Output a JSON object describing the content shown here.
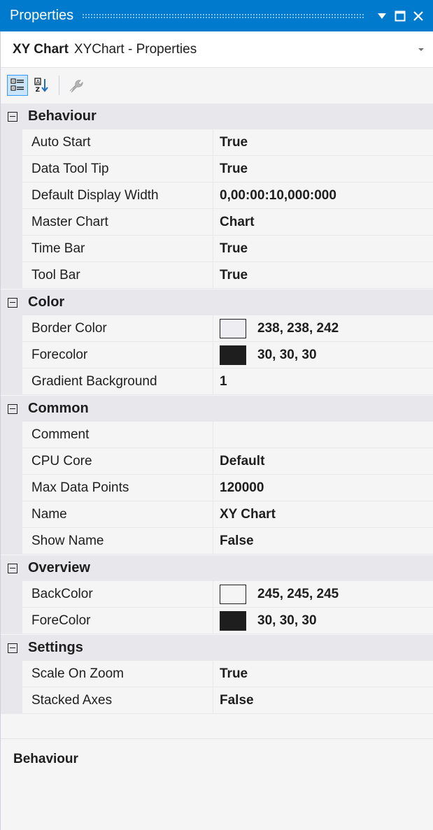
{
  "window": {
    "title": "Properties",
    "buttons": {
      "dropdown_icon": "triangle-down-icon",
      "maximize_icon": "square-icon",
      "close_icon": "x-icon"
    },
    "accent_color": "#007acc"
  },
  "selector": {
    "object_name": "XY Chart",
    "object_type": "XYChart - Properties"
  },
  "toolbar": {
    "categorized_icon": "categorized-icon",
    "alphabetical_icon": "sort-az-icon",
    "property_pages_icon": "wrench-icon"
  },
  "categories": [
    {
      "label": "Behaviour",
      "properties": [
        {
          "name": "Auto Start",
          "value": "True"
        },
        {
          "name": "Data Tool Tip",
          "value": "True"
        },
        {
          "name": "Default Display Width",
          "value": "0,00:00:10,000:000"
        },
        {
          "name": "Master Chart",
          "value": "Chart"
        },
        {
          "name": "Time Bar",
          "value": "True"
        },
        {
          "name": "Tool Bar",
          "value": "True"
        }
      ]
    },
    {
      "label": "Color",
      "properties": [
        {
          "name": "Border Color",
          "value": "238, 238, 242",
          "swatch": "#eeeef2"
        },
        {
          "name": "Forecolor",
          "value": "30, 30, 30",
          "swatch": "#1e1e1e"
        },
        {
          "name": "Gradient Background",
          "value": "1"
        }
      ]
    },
    {
      "label": "Common",
      "properties": [
        {
          "name": "Comment",
          "value": ""
        },
        {
          "name": "CPU Core",
          "value": "Default"
        },
        {
          "name": "Max Data Points",
          "value": "120000"
        },
        {
          "name": "Name",
          "value": "XY Chart"
        },
        {
          "name": "Show Name",
          "value": "False"
        }
      ]
    },
    {
      "label": "Overview",
      "properties": [
        {
          "name": "BackColor",
          "value": "245, 245, 245",
          "swatch": "#f5f5f5"
        },
        {
          "name": "ForeColor",
          "value": "30, 30, 30",
          "swatch": "#1e1e1e"
        }
      ]
    },
    {
      "label": "Settings",
      "properties": [
        {
          "name": "Scale On Zoom",
          "value": "True"
        },
        {
          "name": "Stacked Axes",
          "value": "False"
        }
      ]
    }
  ],
  "description": {
    "title": "Behaviour"
  }
}
